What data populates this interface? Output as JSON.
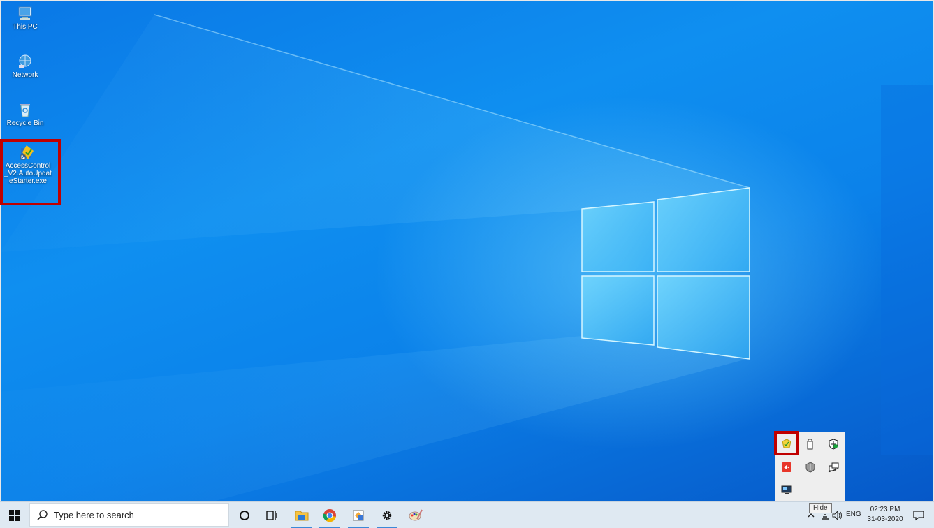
{
  "desktop": {
    "icons": [
      {
        "label": "This PC"
      },
      {
        "label": "Network"
      },
      {
        "label": "Recycle Bin"
      },
      {
        "label": "AccessControl_V2.AutoUpdateStarter.exe"
      }
    ]
  },
  "taskbar": {
    "search_placeholder": "Type here to search",
    "language": "ENG",
    "time": "02:23 PM",
    "date": "31-03-2020",
    "apps": [
      "cortana",
      "task-view",
      "file-explorer",
      "chrome",
      "app-installer",
      "settings",
      "paint"
    ]
  },
  "tray": {
    "tooltip": "Hide",
    "popup_icons": [
      "access-control-shield",
      "usb-drive",
      "windows-security",
      "remote-app",
      "security-shield",
      "network-share",
      "display-monitor"
    ]
  },
  "colors": {
    "highlight": "#c00000",
    "accent": "#3c8ad8"
  }
}
